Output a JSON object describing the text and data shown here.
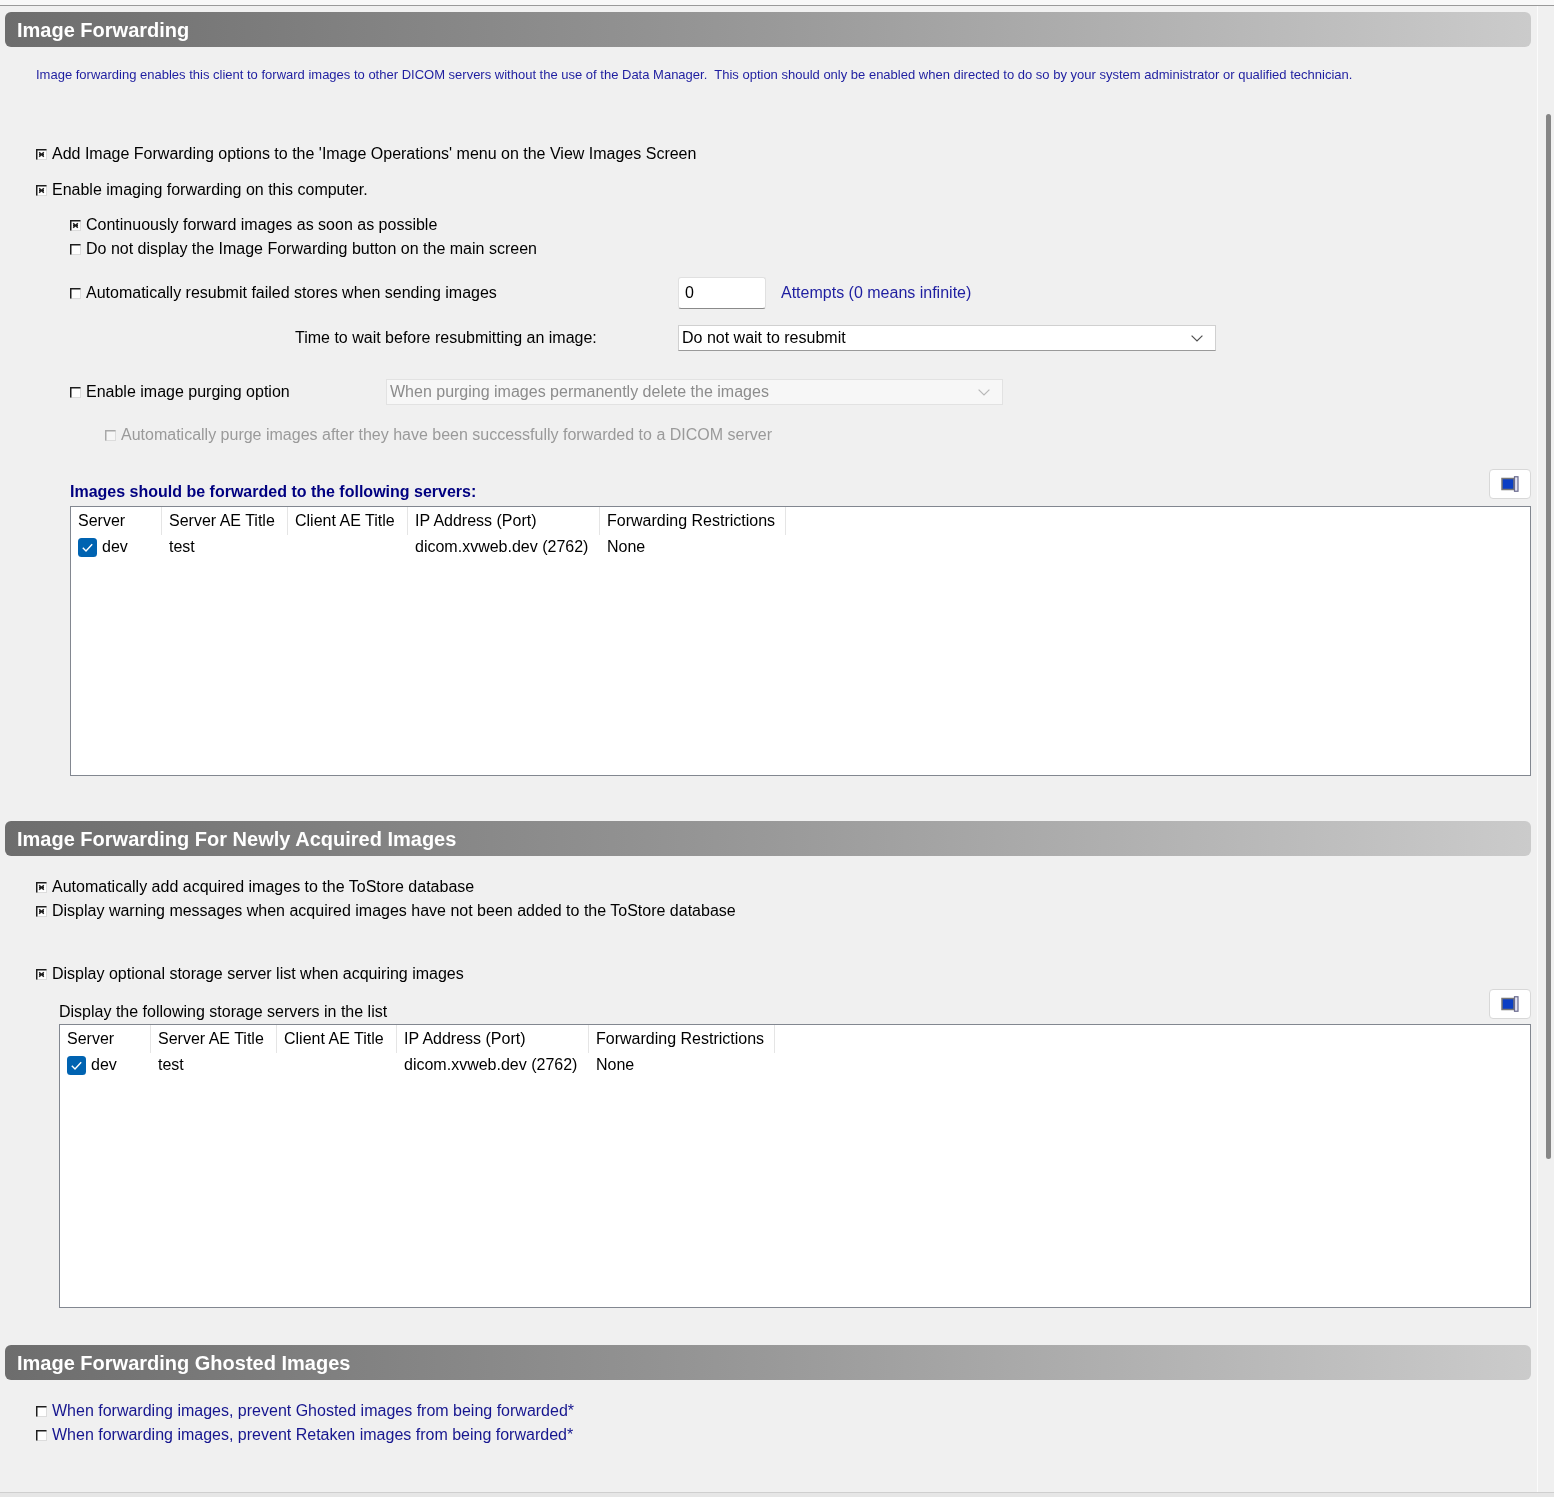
{
  "sections": [
    {
      "title": "Image Forwarding",
      "description": "Image forwarding enables this client to forward images to other DICOM servers without the use of the Data Manager.  This option should only be enabled when directed to do so by your system administrator or qualified technician.",
      "accent_labels": false,
      "groups": [
        [
          {
            "kind": "checkbox",
            "label": "Add Image Forwarding options to the 'Image Operations' menu on the View Images Screen",
            "checked": true,
            "disabled": false
          }
        ],
        [
          {
            "kind": "checkbox",
            "label": "Enable imaging forwarding on this computer.",
            "checked": true,
            "disabled": false,
            "children": [
              {
                "kind": "checkbox",
                "label": "Continuously forward images as soon as possible",
                "checked": true,
                "disabled": false
              },
              {
                "kind": "checkbox",
                "label": "Do not display the Image Forwarding button on the main screen",
                "checked": false,
                "disabled": false
              },
              {
                "kind": "checkbox",
                "label": "Automatically resubmit failed stores when sending images",
                "checked": false,
                "disabled": false,
                "field": {
                  "value": "0"
                },
                "field_note": "Attempts (0 means infinite)"
              },
              {
                "kind": "select",
                "label": "Time to wait before resubmitting an image:",
                "value": "Do not wait to resubmit",
                "disabled": false
              },
              {
                "kind": "checkbox",
                "label": "Enable image purging option",
                "checked": false,
                "disabled": false,
                "select": {
                  "value": "When purging images permanently delete the images",
                  "disabled": true
                },
                "children": [
                  {
                    "kind": "checkbox",
                    "label": "Automatically purge images after they have been successfully forwarded to a DICOM server",
                    "checked": false,
                    "disabled": true
                  }
                ]
              },
              {
                "kind": "server_list",
                "caption": "Images should be forwarded to the following servers:",
                "caption_emphasis": true,
                "columns": [
                  "Server",
                  "Server AE Title",
                  "Client AE Title",
                  "IP Address (Port)",
                  "Forwarding Restrictions"
                ],
                "rows": [
                  {
                    "checked": true,
                    "cells": [
                      "dev",
                      "test",
                      null,
                      "dicom.xvweb.dev (2762)",
                      "None"
                    ]
                  }
                ]
              }
            ]
          }
        ]
      ]
    },
    {
      "title": "Image Forwarding For Newly Acquired Images",
      "accent_labels": false,
      "groups": [
        [
          {
            "kind": "checkbox",
            "label": "Automatically add acquired images to the ToStore database",
            "checked": true,
            "disabled": false
          },
          {
            "kind": "checkbox",
            "label": "Display warning messages when acquired images have not been added to the ToStore database",
            "checked": true,
            "disabled": false
          }
        ],
        [
          {
            "kind": "checkbox",
            "label": "Display optional storage server list when acquiring images",
            "checked": true,
            "disabled": false
          },
          {
            "kind": "server_list",
            "caption": "Display the following storage servers in the list",
            "caption_emphasis": false,
            "columns": [
              "Server",
              "Server AE Title",
              "Client AE Title",
              "IP Address (Port)",
              "Forwarding Restrictions"
            ],
            "rows": [
              {
                "checked": true,
                "cells": [
                  "dev",
                  "test",
                  null,
                  "dicom.xvweb.dev (2762)",
                  "None"
                ]
              }
            ]
          }
        ]
      ]
    },
    {
      "title": "Image Forwarding Ghosted Images",
      "accent_labels": true,
      "groups": [
        [
          {
            "kind": "checkbox",
            "label": "When forwarding images, prevent Ghosted images from being forwarded*",
            "checked": false,
            "disabled": false
          },
          {
            "kind": "checkbox",
            "label": "When forwarding images, prevent Retaken images from being forwarded*",
            "checked": false,
            "disabled": false
          }
        ]
      ]
    }
  ]
}
